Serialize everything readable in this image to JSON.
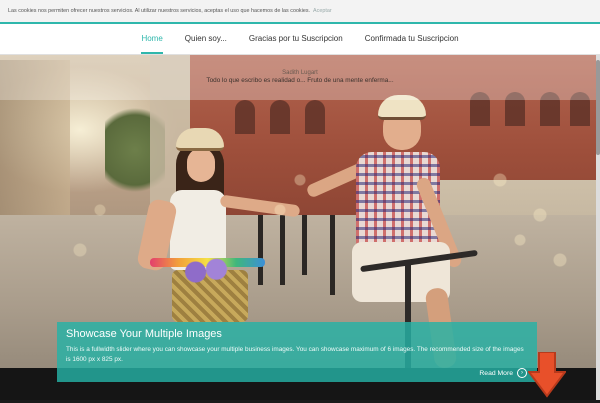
{
  "cookie_bar": {
    "message": "Las cookies nos permiten ofrecer nuestros servicios. Al utilizar nuestros servicios, aceptas el uso que hacemos de las cookies.",
    "accept_label": "Aceptar"
  },
  "nav": {
    "items": [
      {
        "label": "Home",
        "active": true
      },
      {
        "label": "Quien soy...",
        "active": false
      },
      {
        "label": "Gracias por tu Suscripcion",
        "active": false
      },
      {
        "label": "Confirmada tu Suscripcion",
        "active": false
      }
    ]
  },
  "header": {
    "author": "Sadith Lugart",
    "tagline": "Todo lo que escribo es realidad o... Fruto de una mente enferma..."
  },
  "slider": {
    "title": "Showcase Your Multiple Images",
    "text": "This is a fullwidth slider where you can showcase your multiple business images. You can showcase maximum of 6 images. The recommended size of the images is 1600 px x 825 px.",
    "read_more": "Read More",
    "read_more_icon": "arrow-right-circle-icon"
  },
  "colors": {
    "accent": "#2fb7ac",
    "scroll_arrow": "#e8502a"
  },
  "scroll_top": {
    "icon": "arrow-down-icon"
  }
}
